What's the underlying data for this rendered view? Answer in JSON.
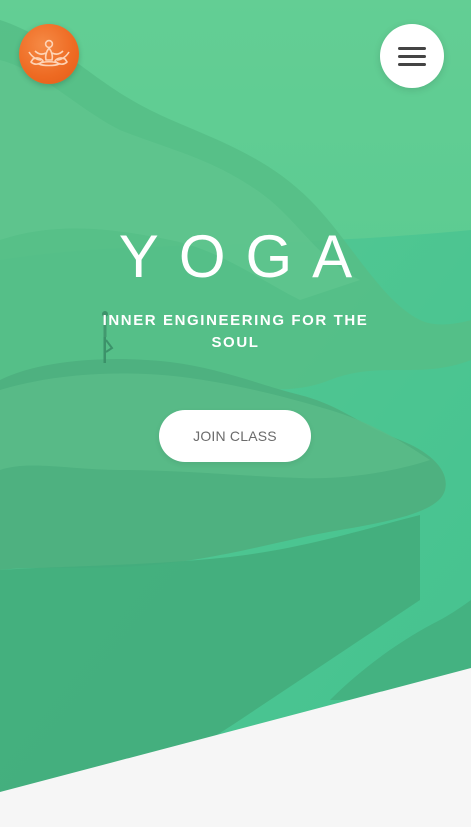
{
  "header": {
    "logo_icon": "lotus-meditation-icon",
    "menu_icon": "hamburger-menu-icon"
  },
  "hero": {
    "title": "YOGA",
    "subtitle": "INNER ENGINEERING FOR THE SOUL",
    "cta_label": "JOIN CLASS"
  },
  "colors": {
    "accent": "#ee6a22",
    "overlay_green": "#4cc88f",
    "button_bg": "#ffffff",
    "button_text": "#6b6b6b",
    "page_bg": "#f6f6f6"
  }
}
